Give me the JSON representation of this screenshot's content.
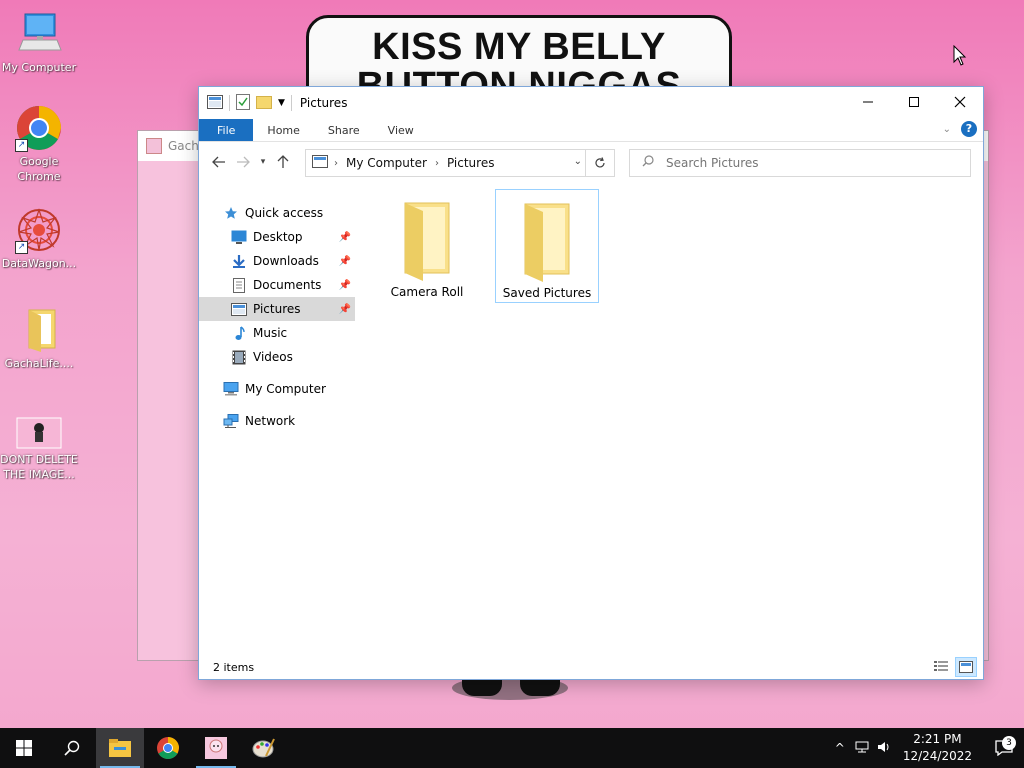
{
  "desktop": {
    "icons": [
      {
        "label": "My Computer"
      },
      {
        "label": "Google Chrome"
      },
      {
        "label": "DataWagon..."
      },
      {
        "label": "GachaLife...."
      },
      {
        "label": "DONT DELETE THE IMAGE..."
      }
    ],
    "wallpaper_sign": {
      "line1": "KISS MY BELLY",
      "line2": "BUTTON NIGGAS"
    }
  },
  "background_window": {
    "title": "Gacha"
  },
  "explorer": {
    "title": "Pictures",
    "ribbon_tabs": [
      "File",
      "Home",
      "Share",
      "View"
    ],
    "help_label": "?",
    "address": {
      "crumbs": [
        "My Computer",
        "Pictures"
      ]
    },
    "search": {
      "placeholder": "Search Pictures"
    },
    "nav": {
      "quick_access": "Quick access",
      "items": [
        {
          "label": "Desktop",
          "icon": "desktop-icon"
        },
        {
          "label": "Downloads",
          "icon": "downloads-icon"
        },
        {
          "label": "Documents",
          "icon": "documents-icon"
        },
        {
          "label": "Pictures",
          "icon": "pictures-icon"
        },
        {
          "label": "Music",
          "icon": "music-icon"
        },
        {
          "label": "Videos",
          "icon": "videos-icon"
        }
      ],
      "my_computer": "My Computer",
      "network": "Network"
    },
    "folders": [
      {
        "name": "Camera Roll"
      },
      {
        "name": "Saved Pictures"
      }
    ],
    "status": "2 items"
  },
  "taskbar": {
    "time": "2:21 PM",
    "date": "12/24/2022",
    "notification_count": "3"
  },
  "colors": {
    "accent": "#1a6fc1",
    "selection": "#cce8ff",
    "folder": "#f5d76e"
  }
}
